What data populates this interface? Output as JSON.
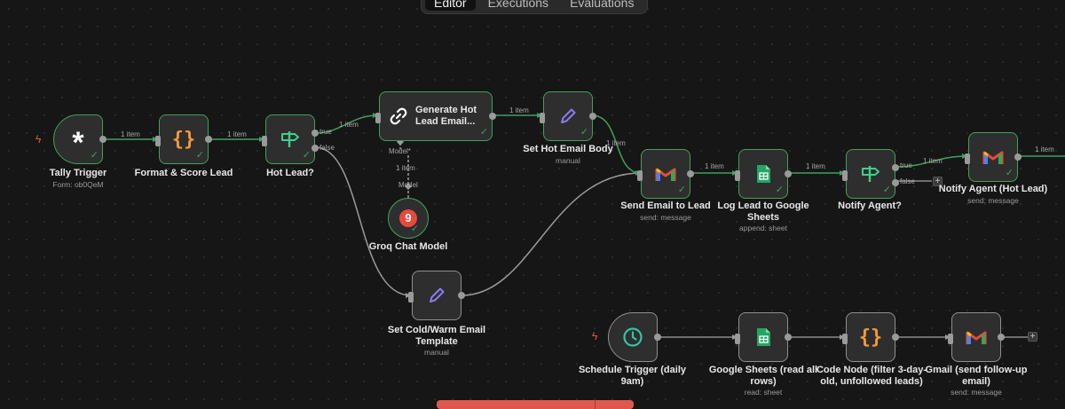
{
  "tabs": [
    "Editor",
    "Executions",
    "Evaluations"
  ],
  "active_tab": "Editor",
  "nodes": {
    "tally_trigger": {
      "label": "Tally Trigger",
      "sub": "Form: ob0QeM",
      "icon": "asterisk-icon"
    },
    "format_score": {
      "label": "Format & Score Lead",
      "icon": "braces-icon"
    },
    "hot_lead": {
      "label": "Hot Lead?",
      "icon": "signpost-icon"
    },
    "generate_email": {
      "label": "Generate Hot Lead Email...",
      "label_line1": "Generate Hot",
      "label_line2": "Lead Email...",
      "icon": "link-icon"
    },
    "groq_model": {
      "label": "Groq Chat Model",
      "icon": "groq-icon",
      "glyph": "9"
    },
    "set_hot_body": {
      "label": "Set Hot Email Body",
      "sub": "manual",
      "icon": "pencil-icon"
    },
    "set_cold_warm": {
      "label": "Set Cold/Warm Email Template",
      "label_line1": "Set Cold/Warm Email",
      "label_line2": "Template",
      "sub": "manual",
      "icon": "pencil-icon"
    },
    "send_email": {
      "label": "Send Email to Lead",
      "sub": "send: message",
      "icon": "gmail-icon"
    },
    "log_lead": {
      "label": "Log Lead to Google Sheets",
      "label_line1": "Log Lead to Google",
      "label_line2": "Sheets",
      "sub": "append: sheet",
      "icon": "google-sheets-icon"
    },
    "notify_agent": {
      "label": "Notify Agent?",
      "icon": "signpost-icon"
    },
    "notify_hot": {
      "label": "Notify Agent (Hot Lead)",
      "sub": "send: message",
      "icon": "gmail-icon"
    },
    "schedule": {
      "label": "Schedule Trigger (daily 9am)",
      "label_line1": "Schedule Trigger (daily",
      "label_line2": "9am)",
      "icon": "clock-icon"
    },
    "gsheets_read": {
      "label": "Google Sheets (read all rows)",
      "label_line1": "Google Sheets (read all",
      "label_line2": "rows)",
      "sub": "read: sheet",
      "icon": "google-sheets-icon"
    },
    "code_node": {
      "label": "Code Node (filter 3-day-old, unfollowed leads)",
      "label_line1": "Code Node (filter 3-day-",
      "label_line2": "old, unfollowed leads)",
      "icon": "braces-icon"
    },
    "gmail_followup": {
      "label": "Gmail (send follow-up email)",
      "label_line1": "Gmail (send follow-up",
      "label_line2": "email)",
      "sub": "send: message",
      "icon": "gmail-icon"
    }
  },
  "edge_labels": {
    "one_item": "1 item",
    "true": "true",
    "false": "false",
    "model": "Model",
    "model_required": "Model*"
  },
  "glyphs": {
    "asterisk": "*",
    "braces": "{}",
    "check": "✓",
    "plus": "+",
    "bolt": "ϟ"
  },
  "colors": {
    "accent_green": "#3fa15e",
    "sheets_green": "#23a566",
    "braces_orange": "#f29a38",
    "pencil_purple": "#8a7cf0",
    "groq_red": "#e8493d",
    "clock_teal": "#35c3a5",
    "bottom_bar": "#e0584d"
  }
}
